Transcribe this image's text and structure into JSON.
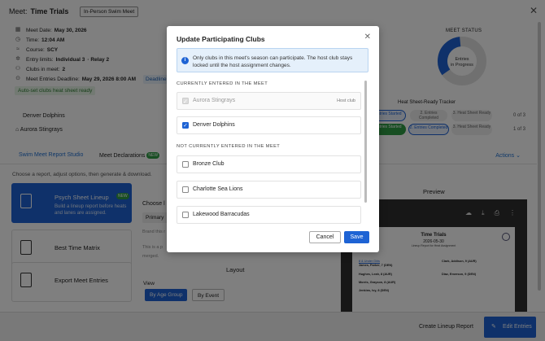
{
  "header": {
    "meet_label": "Meet:",
    "meet_name": "Time Trials",
    "badge": "In-Person Swim Meet"
  },
  "meet_info": [
    {
      "icon": "calendar-icon",
      "label": "Meet Date:",
      "value": "May 30, 2026",
      "extra": ""
    },
    {
      "icon": "clock-icon",
      "label": "Time:",
      "value": "12:04 AM",
      "extra": ""
    },
    {
      "icon": "pool-icon",
      "label": "Course:",
      "value": "SCY",
      "extra": ""
    },
    {
      "icon": "entries-icon",
      "label": "Entry limits:",
      "value": "Individual 3",
      "extra": "· Relay 2"
    },
    {
      "icon": "clubs-icon",
      "label": "Clubs in meet:",
      "value": "2",
      "extra": ""
    },
    {
      "icon": "deadline-icon",
      "label": "Meet Entries Deadline:",
      "value": "May 29, 2026 8:00 AM",
      "extra": ""
    }
  ],
  "deadline_chip": "Deadline",
  "auto_set_note": "Auto-set clubs heat sheet ready",
  "background_clubs": [
    "Denver Dolphins",
    "Aurora Stingrays"
  ],
  "meet_status": {
    "title": "MEET STATUS",
    "donut_label_1": "Entries",
    "donut_label_2": "in Progress",
    "colors": {
      "progress": "#1e63d4",
      "track": "#e0e0e0"
    }
  },
  "tracker": {
    "title": "Heat Sheet-Ready Tracker",
    "rows": [
      {
        "step1": "Entries Started",
        "step2": "2. Entries Completed",
        "step3": "3. Heat Sheet Ready",
        "count": "0 of 3"
      },
      {
        "step1": "Entries Started",
        "step2": "2. Entries Completed",
        "step3": "3. Heat Sheet Ready",
        "count": "1 of 3"
      }
    ]
  },
  "tabs": {
    "studio": "Swim Meet Report Studio",
    "declarations": "Meet Declarations",
    "declarations_badge": "NEW",
    "actions": "Actions"
  },
  "subtitle": "Choose a report, adjust options, then generate & download.",
  "report_cards": [
    {
      "title": "Psych Sheet Lineup",
      "badge": "NEW",
      "desc": "Build a lineup report before heats and lanes are assigned.",
      "active": true
    },
    {
      "title": "Best Time Matrix",
      "active": false
    },
    {
      "title": "Export Meet Entries",
      "active": false
    }
  ],
  "options": {
    "choose_label": "Choose l",
    "select_value": "Primary",
    "faded_1": "Brand this r",
    "faded_2": "This is a p",
    "faded_3": "merged.",
    "layout_title": "Layout",
    "view_label": "View",
    "view_age": "By Age Group",
    "view_event": "By Event"
  },
  "preview": {
    "title": "Preview",
    "paper_title": "Time Trials",
    "paper_date": "2026-05-30",
    "paper_sub": "Lineup Report for Heat Assignment",
    "left_header": "8 & Under Girls",
    "left_swimmers": [
      "James, Parker, 7 (DEN)",
      "Hughes, Leah, 8 (AUR)",
      "Morris, Grayson, 8 (AUR)",
      "Jenkins, Ivy, 8 (DEN)"
    ],
    "right_swimmers": [
      "Clark, Addison, 9 (AUR)",
      "Diaz, Emerson, 9 (DEN)"
    ]
  },
  "bottom": {
    "create": "Create Lineup Report",
    "edit": "Edit Entries"
  },
  "modal": {
    "title": "Update Participating Clubs",
    "info": "Only clubs in this meet's season can participate. The host club stays locked until the host assignment changes.",
    "section_entered": "CURRENTLY ENTERED IN THE MEET",
    "entered": [
      {
        "name": "Aurora Stingrays",
        "tag": "Host club",
        "checked": true,
        "disabled": true
      },
      {
        "name": "Denver Dolphins",
        "tag": "",
        "checked": true,
        "disabled": false
      }
    ],
    "section_not_entered": "NOT CURRENTLY ENTERED IN THE MEET",
    "not_entered": [
      {
        "name": "Bronze Club",
        "checked": false
      },
      {
        "name": "Charlotte Sea Lions",
        "checked": false
      },
      {
        "name": "Lakewood Barracudas",
        "checked": false
      }
    ],
    "cancel": "Cancel",
    "save": "Save",
    "accent": "#1e63d4"
  }
}
